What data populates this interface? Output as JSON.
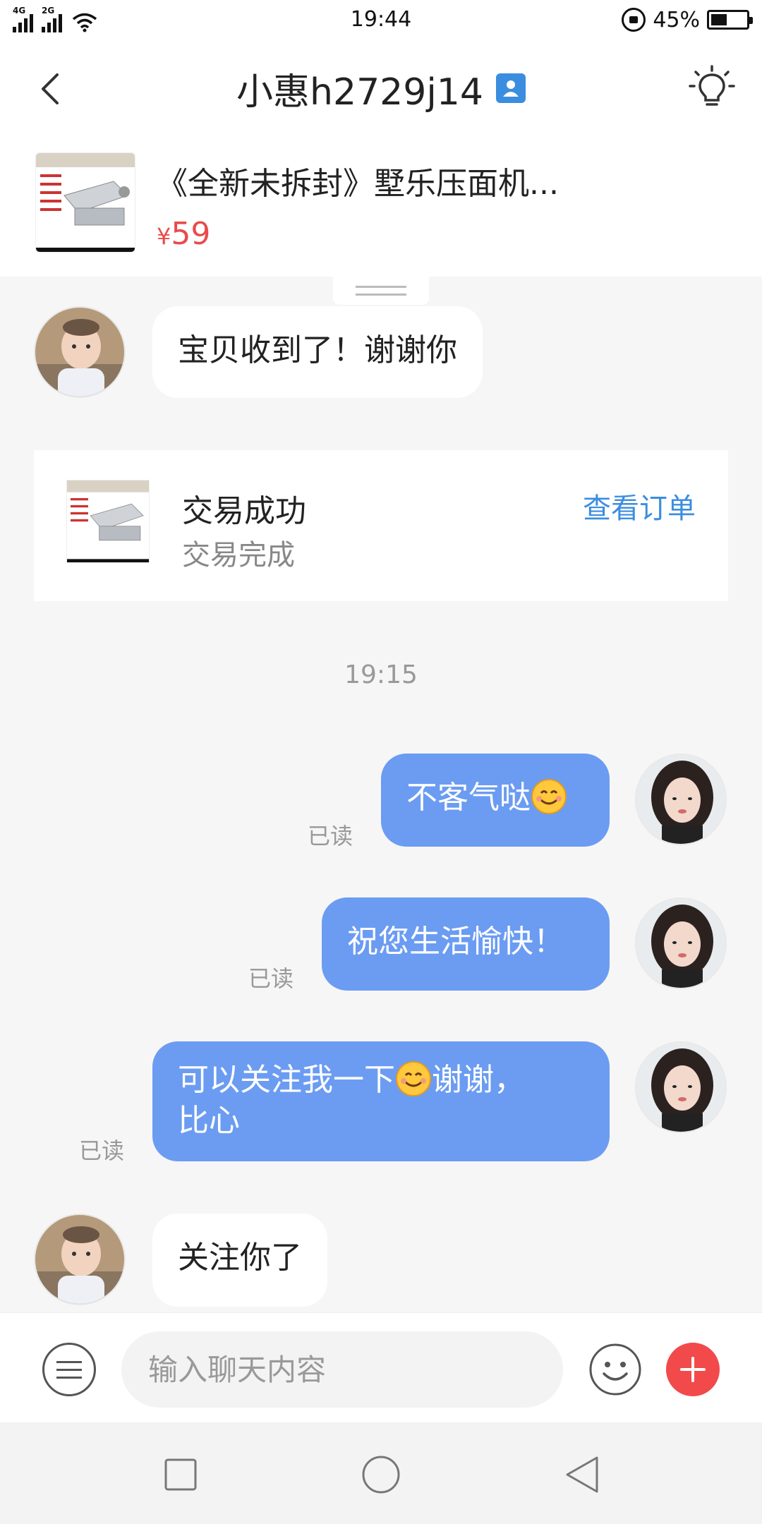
{
  "status_bar": {
    "net1": "4G",
    "net2": "2G",
    "time": "19:44",
    "battery": "45%",
    "battery_level": 0.45
  },
  "header": {
    "title": "小惠h2729j14",
    "back_icon": "chevron-left-icon",
    "verify_icon": "user-badge-icon",
    "bulb_icon": "lightbulb-icon"
  },
  "product": {
    "title": "《全新未拆封》墅乐压面机...",
    "currency": "¥",
    "price": "59"
  },
  "messages": [
    {
      "side": "left",
      "text": "宝贝收到了！谢谢你"
    },
    {
      "side": "right",
      "text": "不客气哒",
      "emoji": "smile",
      "read": "已读"
    },
    {
      "side": "right",
      "text": "祝您生活愉快！",
      "read": "已读"
    },
    {
      "side": "right",
      "text_a": "可以关注我一下",
      "emoji": "smile",
      "text_b": "谢谢，",
      "text_c": "比心",
      "read": "已读"
    },
    {
      "side": "left",
      "text": "关注你了"
    }
  ],
  "order_card": {
    "title": "交易成功",
    "status": "交易完成",
    "link": "查看订单"
  },
  "time_label": "19:15",
  "input": {
    "placeholder": "输入聊天内容"
  },
  "colors": {
    "accent_blue": "#3b8de0",
    "bubble_blue": "#6b9cf2",
    "price_red": "#e94b4b",
    "plus_red": "#f24a4a"
  }
}
